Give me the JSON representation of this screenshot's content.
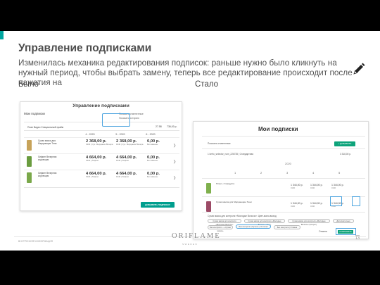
{
  "slide": {
    "title": "Управление подписками",
    "description": "Изменилась механика редактирования подписок: раньше нужно было кликнуть на нужный период, чтобы выбрать замену, теперь все редактирование происходит после нажатия на",
    "label_before": "Было",
    "label_after": "Стало",
    "icons": [
      "pencil-icon"
    ]
  },
  "before": {
    "header": "Управление подписками",
    "my_subs": "Мои подписки",
    "control1": "Показать отмененные",
    "control2": "Показать историю",
    "plan": "План Видео Специальный прайм",
    "sum1": "27.58",
    "sum2": "736,00 р.",
    "months": [
      "4 - 2020",
      "5 - 2020",
      "6 - 2020"
    ],
    "products": [
      {
        "name": "Сухая маска для Мерцающие Тени",
        "cells": [
          {
            "price": "2 368,00 р.",
            "sub": "1940 | Сух. Мерцание Вечера"
          },
          {
            "price": "2 368,00 р.",
            "sub": "1940 | Сух. Мерцание Вечера"
          },
          {
            "price": "0,00 р.",
            "sub": "Без замены"
          }
        ]
      },
      {
        "name": "Лифинг Вечерняя коррекция",
        "cells": [
          {
            "price": "4 664,00 р.",
            "sub": "1940 | Лифинг"
          },
          {
            "price": "4 664,00 р.",
            "sub": "1940 | Лифинг"
          },
          {
            "price": "0,00 р.",
            "sub": "Без замены"
          }
        ]
      },
      {
        "name": "Лифинг Вечерняя коррекция",
        "cells": [
          {
            "price": "4 664,00 р.",
            "sub": "1940 | Лифинг"
          },
          {
            "price": "4 664,00 р.",
            "sub": "1940 | Лифинг"
          },
          {
            "price": "0,00 р.",
            "sub": "Без замены"
          }
        ]
      }
    ],
    "button": "ДОБАВИТЬ ПОДПИСКУ"
  },
  "after": {
    "header": "Мои подписки",
    "show_cancelled": "Показать отмененные",
    "add_button": "+ ДОБАВИТЬ",
    "plan": "1 kerfo_selector_num_226735 | Стандартная",
    "plan_sum": "3 318,00 р.",
    "year": "2020",
    "months": [
      "1",
      "2",
      "3",
      "4",
      "5"
    ],
    "products": [
      {
        "name": "Плюс+ 3 продукта",
        "prices": [
          "1 344,00 р.",
          "1 344,00 р.",
          "1 344,00 р."
        ],
        "subs": [
          "0190",
          "0190",
          "0190"
        ]
      },
      {
        "name": "Сухая маска для Мерцающие Тени",
        "prices": [
          "1 344,00 р.",
          "1 344,00 р.",
          "1 344,00 р."
        ],
        "subs": [
          "0190",
          "0190",
          "0190"
        ]
      }
    ],
    "chips_title": "Сухая маска для контроля «Молодые Волосы»: Цвет-мало-выход",
    "chips": [
      "Сухая маска для контроля «Молодые Волосы»",
      "Сухая маска для контроля «Молодые Волосы» (Арт.)",
      "Сухая маска для контроля «Молодые Волосы» (Нагрет.)",
      "Дополнительно",
      "Без контроля — «Сухая маска»",
      "Без контроля «Лучше» | Отлично",
      "Без контроля | Отмена"
    ],
    "cancel": "Отмена",
    "save": "СОХРАНИТЬ"
  },
  "footer": {
    "left": "ВНУТРЕННЯЯ ИНФОРМАЦИЯ",
    "brand": "ORIFLAME",
    "brand_sub": "SWEDEN",
    "page": "13"
  },
  "colors": {
    "accent": "#00a6a0",
    "highlight": "#4aa3df",
    "green_button": "#0da37a"
  }
}
